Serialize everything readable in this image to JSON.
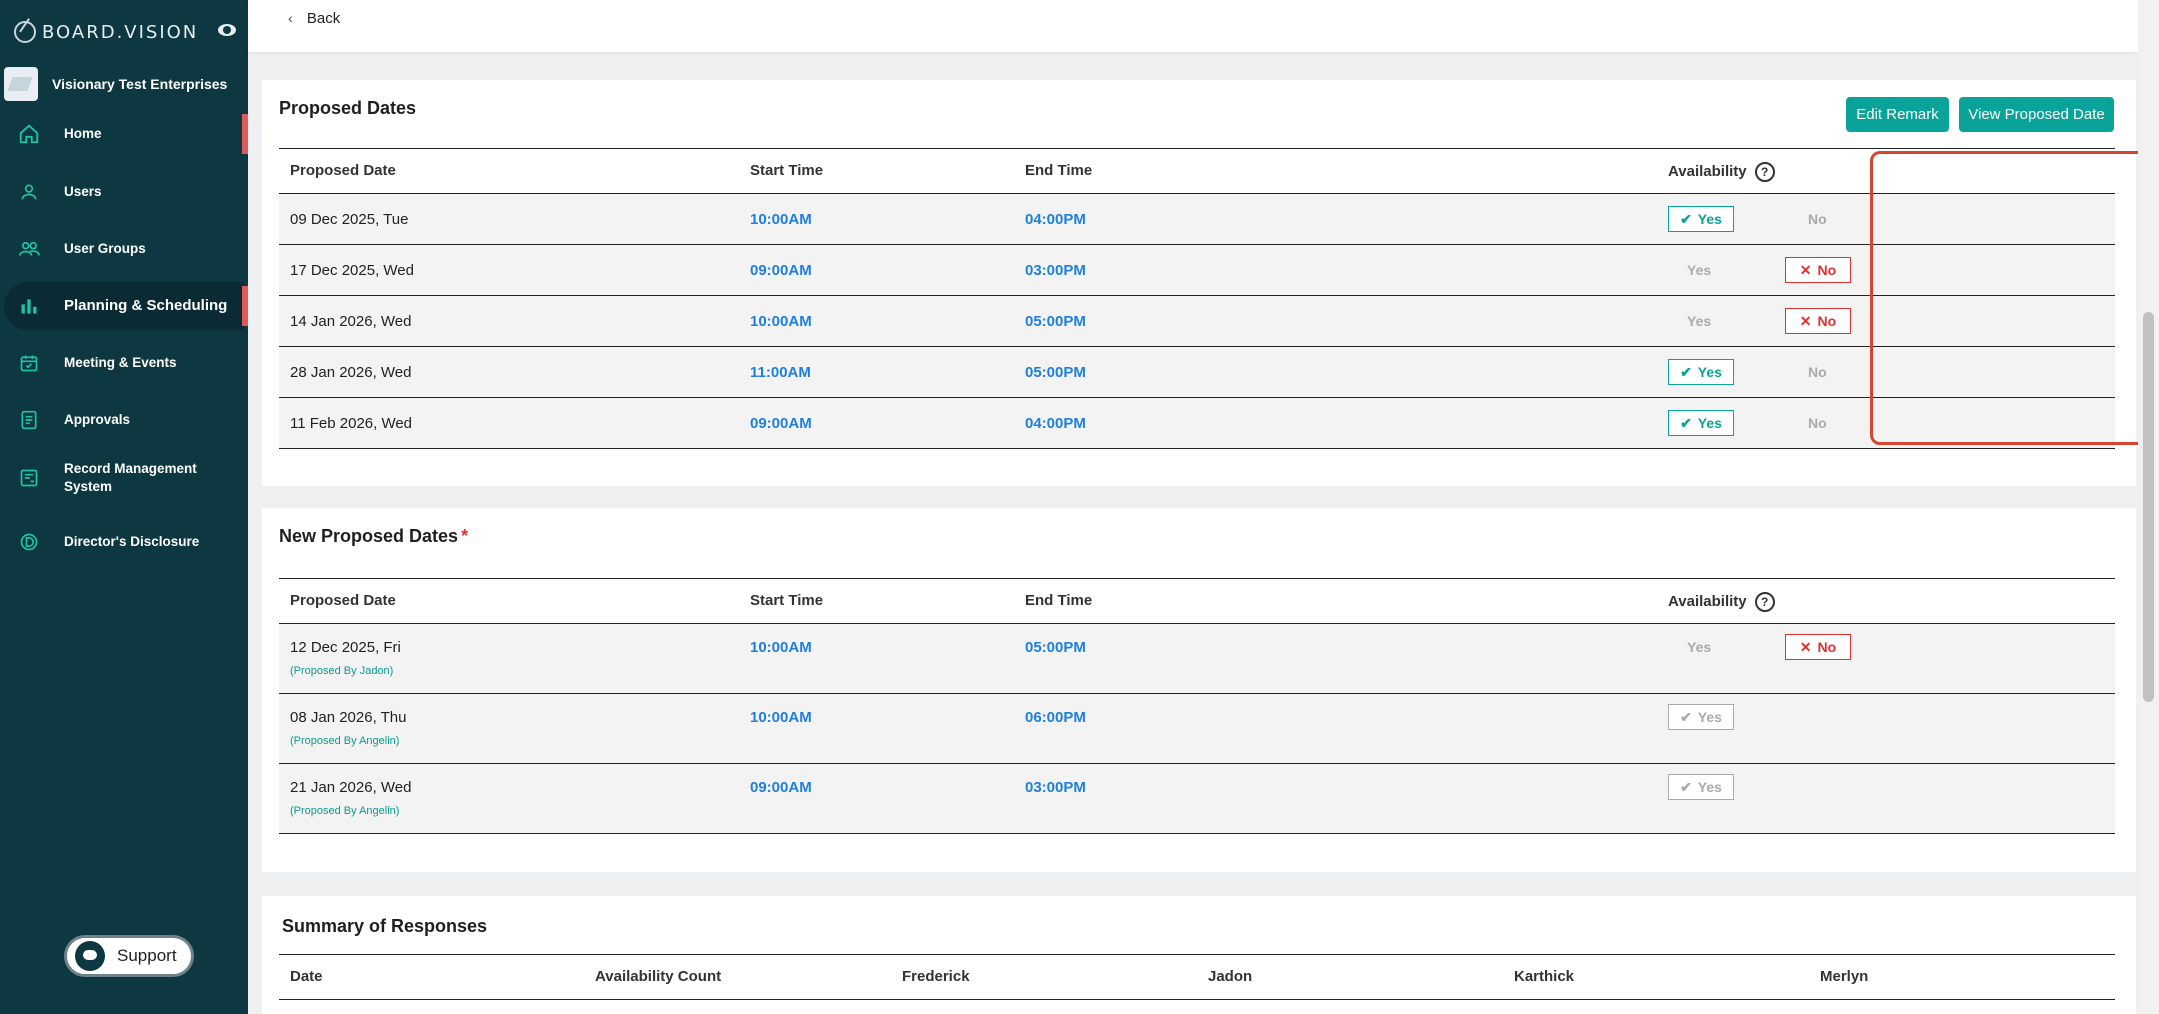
{
  "sidebar": {
    "logo": "BOARD.VISION",
    "org_name": "Visionary Test Enterprises",
    "items": [
      {
        "label": "Home",
        "icon": "home-icon"
      },
      {
        "label": "Users",
        "icon": "user-icon"
      },
      {
        "label": "User Groups",
        "icon": "user-group-icon"
      },
      {
        "label": "Planning & Scheduling",
        "icon": "bar-chart-icon"
      },
      {
        "label": "Meeting & Events",
        "icon": "calendar-icon"
      },
      {
        "label": "Approvals",
        "icon": "document-icon"
      },
      {
        "label": "Record Management System",
        "icon": "record-icon"
      },
      {
        "label": "Director's Disclosure",
        "icon": "disclosure-icon"
      }
    ],
    "support_label": "Support"
  },
  "topbar": {
    "back_label": "Back"
  },
  "proposed": {
    "title": "Proposed Dates",
    "edit_remark": "Edit Remark",
    "view_proposed": "View Proposed Date",
    "headers": {
      "date": "Proposed Date",
      "start": "Start Time",
      "end": "End Time",
      "availability": "Availability"
    },
    "rows": [
      {
        "date": "09 Dec 2025, Tue",
        "start": "10:00AM",
        "end": "04:00PM",
        "yes": "Yes",
        "no": "No",
        "selected": "yes"
      },
      {
        "date": "17 Dec 2025, Wed",
        "start": "09:00AM",
        "end": "03:00PM",
        "yes": "Yes",
        "no": "No",
        "selected": "no"
      },
      {
        "date": "14 Jan 2026, Wed",
        "start": "10:00AM",
        "end": "05:00PM",
        "yes": "Yes",
        "no": "No",
        "selected": "no"
      },
      {
        "date": "28 Jan 2026, Wed",
        "start": "11:00AM",
        "end": "05:00PM",
        "yes": "Yes",
        "no": "No",
        "selected": "yes"
      },
      {
        "date": "11 Feb 2026, Wed",
        "start": "09:00AM",
        "end": "04:00PM",
        "yes": "Yes",
        "no": "No",
        "selected": "yes"
      }
    ]
  },
  "new_proposed": {
    "title": "New Proposed Dates",
    "required_mark": "*",
    "headers": {
      "date": "Proposed Date",
      "start": "Start Time",
      "end": "End Time",
      "availability": "Availability"
    },
    "rows": [
      {
        "date": "12 Dec 2025, Fri",
        "by": "(Proposed By Jadon)",
        "start": "10:00AM",
        "end": "05:00PM",
        "yes": "Yes",
        "no": "No",
        "selected": "no"
      },
      {
        "date": "08 Jan 2026, Thu",
        "by": "(Proposed By Angelin)",
        "start": "10:00AM",
        "end": "06:00PM",
        "yes": "Yes",
        "selected": "yes-grey"
      },
      {
        "date": "21 Jan 2026, Wed",
        "by": "(Proposed By Angelin)",
        "start": "09:00AM",
        "end": "03:00PM",
        "yes": "Yes",
        "selected": "yes-grey"
      }
    ]
  },
  "summary": {
    "title": "Summary of Responses",
    "headers": [
      "Date",
      "Availability Count",
      "Frederick",
      "Jadon",
      "Karthick",
      "Merlyn"
    ]
  },
  "colors": {
    "sidebar": "#0d3741",
    "accent": "#0aa39a",
    "time": "#1e7fe0",
    "no": "#e03030",
    "highlight": "#d8452f"
  }
}
